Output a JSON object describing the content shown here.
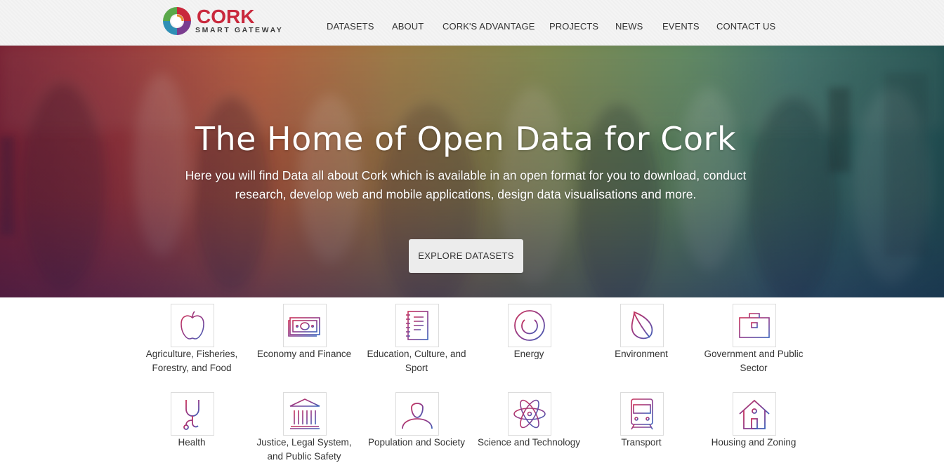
{
  "brand": {
    "word": "CORK",
    "sub": "SMART GATEWAY",
    "colors": {
      "red": "#c9283c",
      "green": "#5aa84a",
      "blue": "#2f6fb5",
      "purple": "#7a3d8f",
      "orange": "#e58a2a"
    }
  },
  "nav": {
    "items": [
      {
        "label": "DATASETS"
      },
      {
        "label": "ABOUT"
      },
      {
        "label": "CORK'S ADVANTAGE"
      },
      {
        "label": "PROJECTS"
      },
      {
        "label": "NEWS"
      },
      {
        "label": "EVENTS"
      },
      {
        "label": "CONTACT US"
      }
    ]
  },
  "hero": {
    "title": "The Home of Open Data for Cork",
    "subtitle": "Here you will find Data all about Cork which is available in an open format for you to download, conduct research, develop web and mobile applications, design data visualisations and more.",
    "button": "EXPLORE DATASETS"
  },
  "categories": [
    {
      "label": "Agriculture, Fisheries, Forestry, and Food",
      "icon": "apple-icon"
    },
    {
      "label": "Economy and Finance",
      "icon": "banknote-icon"
    },
    {
      "label": "Education, Culture, and Sport",
      "icon": "notebook-icon"
    },
    {
      "label": "Energy",
      "icon": "power-icon"
    },
    {
      "label": "Environment",
      "icon": "leaf-icon"
    },
    {
      "label": "Government and Public Sector",
      "icon": "briefcase-icon"
    },
    {
      "label": "Health",
      "icon": "stethoscope-icon"
    },
    {
      "label": "Justice, Legal System, and Public Safety",
      "icon": "courthouse-icon"
    },
    {
      "label": "Population and Society",
      "icon": "person-icon"
    },
    {
      "label": "Science and Technology",
      "icon": "atom-icon"
    },
    {
      "label": "Transport",
      "icon": "train-icon"
    },
    {
      "label": "Housing and Zoning",
      "icon": "house-icon"
    }
  ],
  "icon_gradient": {
    "from": "#c0335a",
    "to": "#3b5fb8"
  }
}
